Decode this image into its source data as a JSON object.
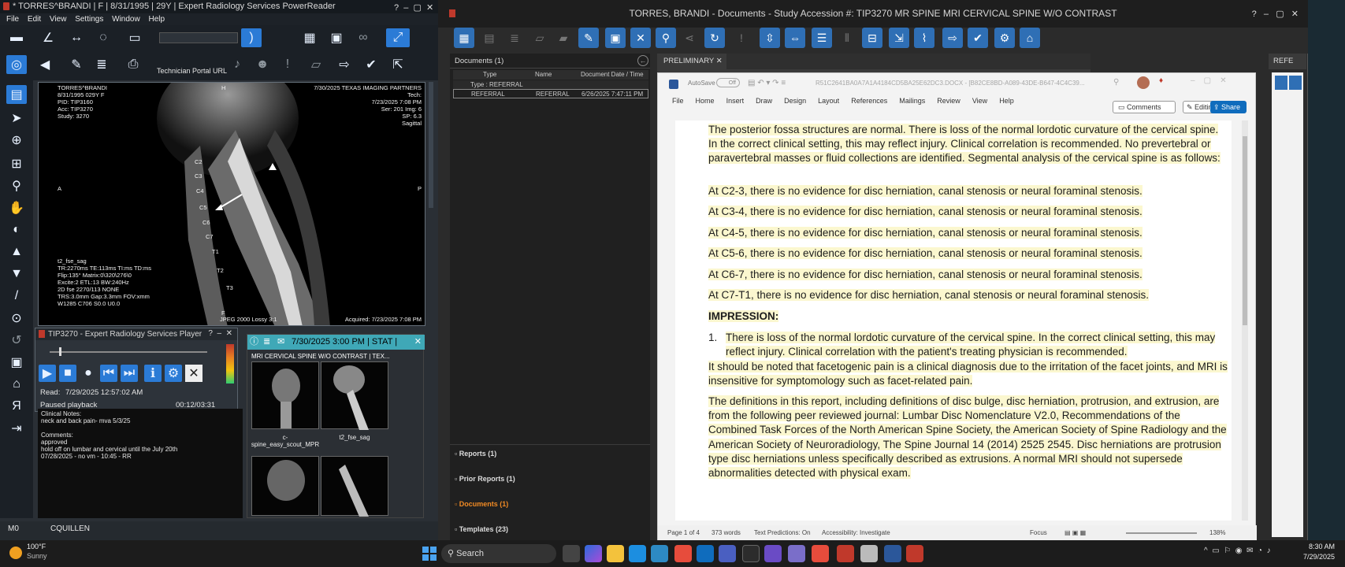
{
  "left_window": {
    "title": "* TORRES^BRANDI | F | 8/31/1995 | 29Y | Expert Radiology Services PowerReader",
    "menu": [
      "File",
      "Edit",
      "View",
      "Settings",
      "Window",
      "Help"
    ],
    "technician_portal_label": "Technician Portal URL",
    "viewer": {
      "tl": "TORRES^BRANDI\n8/31/1995 029Y F\nPID: TIP3160\nAcc: TIP3270\nStudy: 3270",
      "tr": "7/30/2025 TEXAS IMAGING PARTNERS\nTech:\n7/23/2025 7:08 PM\nSer: 201 Img: 6\nSP: 6.3\nSagittal",
      "bl": "t2_fse_sag\nTR:2270ms TE:113ms TI:ms TD:ms\nFlip:135° Matrix:0\\320\\276\\0\nExcite:2 ETL:13 BW:240Hz\n2D fse 2270/113 NONE\nTRS:3.0mm Gap:3.3mm FOV:xmm\nW1285 C706 S0.0 U0.0",
      "bc": "JPEG 2000 Lossy 3:1",
      "br": "Acquired: 7/23/2025 7:08 PM",
      "left_marker": "A",
      "right_marker": "P",
      "top_marker": "H",
      "bottom_marker": "F",
      "vertebrae": [
        "C2",
        "C3",
        "C4",
        "C5",
        "C6",
        "C7",
        "T1",
        "T2",
        "T3"
      ]
    },
    "player": {
      "title": "TIP3270 - Expert Radiology Services Player",
      "read_label": "Read:",
      "read_date": "7/29/2025 12:57:02 AM",
      "state": "Paused playback",
      "time": "00:12/03:31",
      "progress": 0.06
    },
    "notes": "Clinical Notes:\nneck and back pain- mva 5/3/25\n\nComments:\napproved\nhold off on lumbar and cervical until the July 20th\n07/28/2025 - no vm - 10:45 - RR",
    "study_panel": {
      "header": "7/30/2025 3:00 PM | STAT |",
      "title": "MRI CERVICAL SPINE W/O CONTRAST | TEX...",
      "series": [
        {
          "label": "c-spine_easy_scout_MPR"
        },
        {
          "label": "t2_fse_sag"
        }
      ]
    },
    "status": {
      "left": "M0",
      "user": "CQUILLEN"
    }
  },
  "right_window": {
    "title": "TORRES, BRANDI - Documents - Study Accession #: TIP3270 MR SPINE MRI CERVICAL SPINE W/O CONTRAST",
    "documents_panel": {
      "title": "Documents (1)",
      "columns": [
        "Type",
        "Name",
        "Document Date / Time"
      ],
      "group": "Type : REFERRAL",
      "row": {
        "type": "REFERRAL",
        "name": "REFERRAL",
        "date": "6/26/2025 7:47:11 PM"
      },
      "sections": [
        {
          "label": "Reports (1)"
        },
        {
          "label": "Prior Reports (1)"
        },
        {
          "label": "Documents (1)"
        },
        {
          "label": "Templates (23)"
        }
      ]
    },
    "tab": "PRELIMINARY",
    "ref_tab": "REFE",
    "word": {
      "autosave": "AutoSave",
      "autosave_state": "Off",
      "filename": "R51C2641BA0A7A1A4184CD5BA25E62DC3.DOCX - [B82CE8BD-A089-43DE-B647-4C4C39...",
      "ribbon": [
        "File",
        "Home",
        "Insert",
        "Draw",
        "Design",
        "Layout",
        "References",
        "Mailings",
        "Review",
        "View",
        "Help"
      ],
      "comments": "Comments",
      "editing": "Editing",
      "share": "Share",
      "paragraphs": [
        "The posterior fossa structures are normal. There is loss of the normal lordotic curvature of the cervical spine. In the correct clinical setting, this may reflect injury. Clinical correlation is recommended. No prevertebral or paravertebral masses or fluid collections are identified. Segmental analysis of the cervical spine is as follows:",
        "At C2-3, there is no evidence for disc herniation, canal stenosis or neural foraminal stenosis.",
        "At C3-4, there is no evidence for disc herniation, canal stenosis or neural foraminal stenosis.",
        "At C4-5, there is no evidence for disc herniation, canal stenosis or neural foraminal stenosis.",
        "At C5-6, there is no evidence for disc herniation, canal stenosis or neural foraminal stenosis.",
        "At C6-7, there is no evidence for disc herniation, canal stenosis or neural foraminal stenosis.",
        "At C7-T1, there is no evidence for disc herniation, canal stenosis or neural foraminal stenosis."
      ],
      "impression_heading": "IMPRESSION:",
      "impression_num": "1.",
      "impression_item": "There is loss of the normal lordotic curvature of the cervical spine. In the correct clinical setting, this may reflect injury. Clinical correlation with the patient's treating physician is recommended.",
      "facet_note": "It should be noted that facetogenic pain is a clinical diagnosis due to the irritation of the facet joints, and MRI is insensitive for symptomology such as facet-related pain.",
      "definitions": "The definitions in this report, including definitions of disc bulge, disc herniation, protrusion, and extrusion, are from the following peer reviewed journal: Lumbar Disc Nomenclature V2.0, Recommendations of the Combined Task Forces of the North American Spine Society, the American Society of Spine Radiology and the American Society of Neuroradiology, The Spine Journal 14 (2014) 2525 2545. Disc herniations are protrusion type disc herniations unless specifically described as extrusions. A normal MRI should not supersede abnormalities detected with physical exam.",
      "status": {
        "page": "Page 1 of 4",
        "words": "373 words",
        "predictions": "Text Predictions: On",
        "accessibility": "Accessibility: Investigate",
        "focus": "Focus",
        "zoom": "138%"
      }
    }
  },
  "taskbar": {
    "temp": "100°F",
    "weather": "Sunny",
    "search": "Search",
    "time": "8:30 AM",
    "date": "7/29/2025"
  }
}
